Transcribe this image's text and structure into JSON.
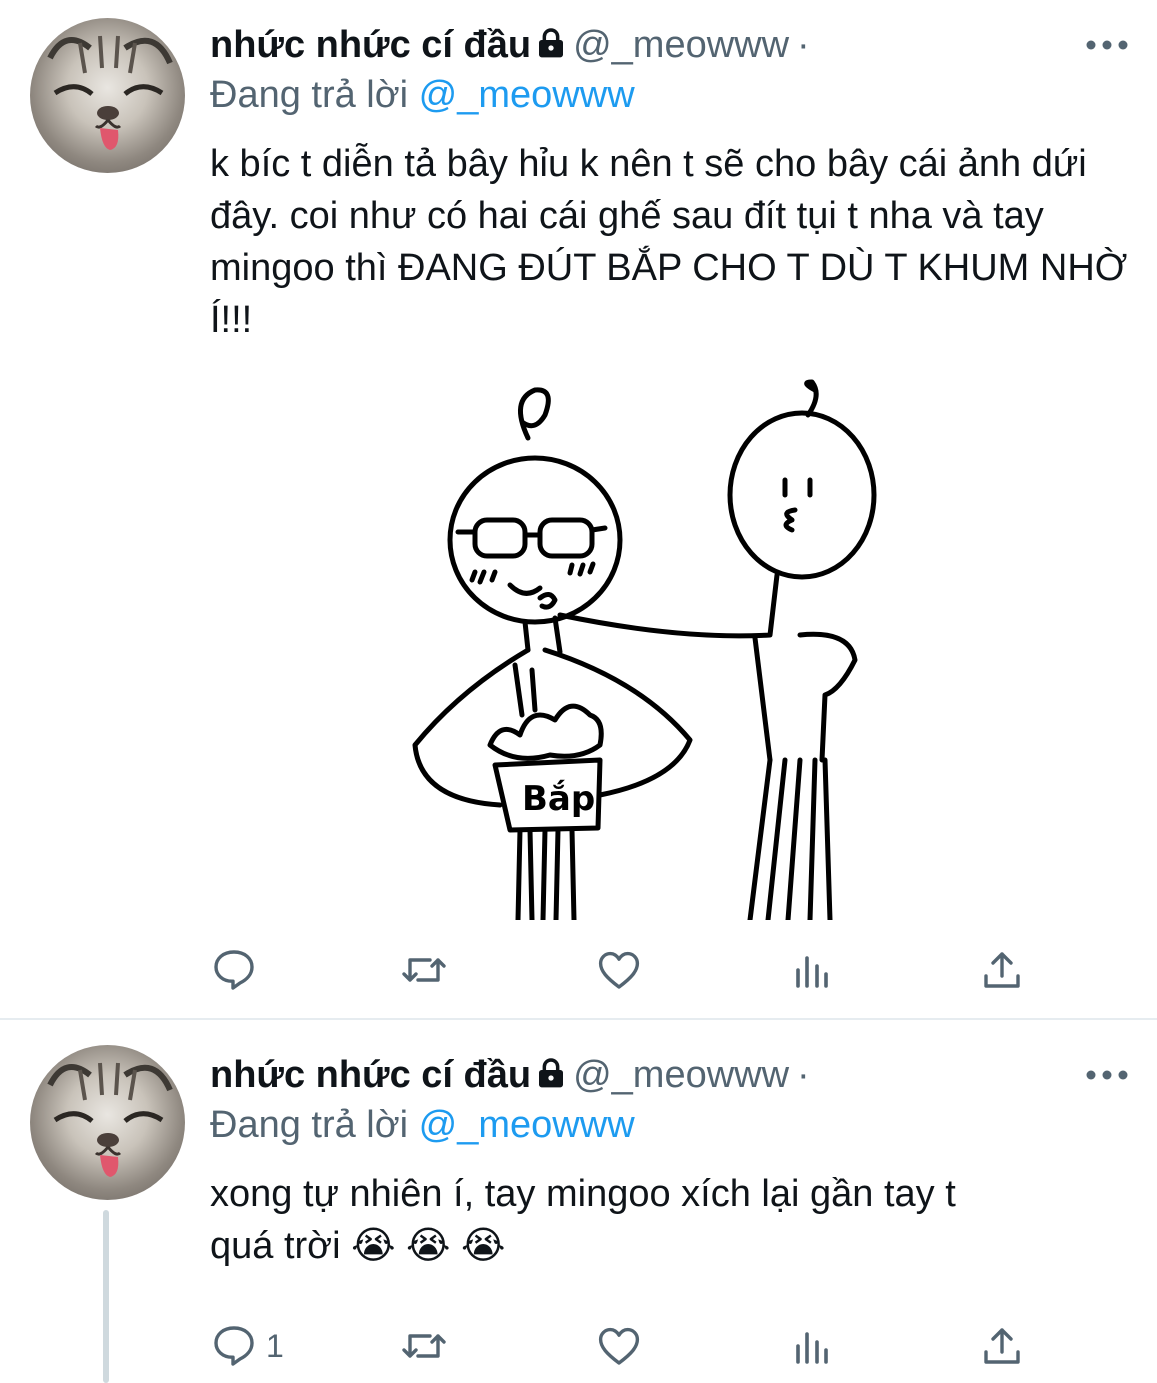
{
  "tweets": [
    {
      "author": {
        "name": "nhức nhức cí đầu",
        "handle": "@_meowww",
        "dot": "·"
      },
      "reply": {
        "prefix": "Đang trả lời",
        "mention": "@_meowww"
      },
      "text": "k bíc t diễn tả bây hỉu k nên t sẽ cho bây cái ảnh dứi đây. coi như có hai cái ghế sau đít tụi t nha và tay mingoo thì ĐANG ĐÚT BẮP CHO T DÙ T KHUM NHỜ Í!!!",
      "media": {
        "drawing_text": "Bắp"
      },
      "actions": {
        "reply": "",
        "retweet": "",
        "like": "",
        "analytics": "",
        "share": ""
      }
    },
    {
      "author": {
        "name": "nhức nhức cí đầu",
        "handle": "@_meowww",
        "dot": "·"
      },
      "reply": {
        "prefix": "Đang trả lời",
        "mention": "@_meowww"
      },
      "text": "xong tự nhiên í, tay mingoo xích lại gần tay t\nquá trời 😭 😭 😭",
      "actions": {
        "reply": "1",
        "retweet": "",
        "like": "",
        "analytics": "",
        "share": ""
      }
    }
  ],
  "colors": {
    "text": "#0f1419",
    "secondary": "#536471",
    "accent": "#1d9bf0",
    "divider": "#e6ecf0"
  },
  "icons": [
    "lock-icon",
    "more-icon",
    "reply-icon",
    "retweet-icon",
    "like-icon",
    "analytics-icon",
    "share-icon"
  ]
}
